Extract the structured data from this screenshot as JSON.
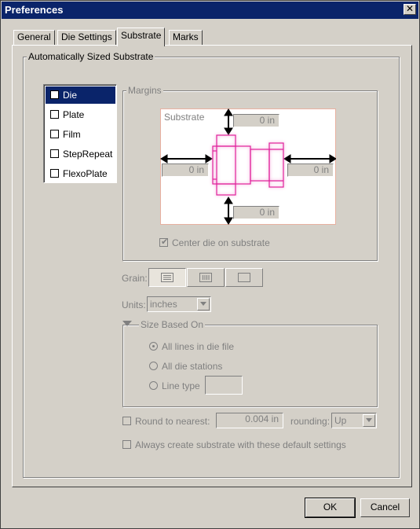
{
  "window": {
    "title": "Preferences",
    "close_label": "✕"
  },
  "tabs": [
    {
      "label": "General"
    },
    {
      "label": "Die Settings"
    },
    {
      "label": "Substrate"
    },
    {
      "label": "Marks"
    }
  ],
  "active_tab": "Substrate",
  "auto_group": {
    "label": "Automatically Sized Substrate"
  },
  "substrate_list": [
    {
      "label": "Die",
      "selected": true,
      "checked": false
    },
    {
      "label": "Plate",
      "selected": false,
      "checked": false
    },
    {
      "label": "Film",
      "selected": false,
      "checked": false
    },
    {
      "label": "StepRepeat",
      "selected": false,
      "checked": false
    },
    {
      "label": "FlexoPlate",
      "selected": false,
      "checked": false
    }
  ],
  "margins": {
    "label": "Margins",
    "preview_label": "Substrate",
    "top": "0 in",
    "left": "0 in",
    "right": "0 in",
    "bottom": "0 in",
    "center_label": "Center die on substrate",
    "center_checked": true
  },
  "grain": {
    "label": "Grain:",
    "icons": [
      "horizontal-grain-icon",
      "vertical-grain-icon",
      "no-grain-icon"
    ]
  },
  "units": {
    "label": "Units:",
    "value": "inches"
  },
  "size_based_on": {
    "label": "Size Based On",
    "options": [
      "All lines in die file",
      "All die stations",
      "Line type"
    ],
    "selected_index": 0,
    "line_type_value": ""
  },
  "round": {
    "label": "Round to nearest:",
    "value": "0.004 in",
    "rounding_label": "rounding:",
    "rounding_value": "Up",
    "checked": false
  },
  "always_create": {
    "label": "Always create substrate with these default settings",
    "checked": false
  },
  "buttons": {
    "ok": "OK",
    "cancel": "Cancel"
  },
  "colors": {
    "titlebar": "#0a246a",
    "die_outline": "#e0209a",
    "selection": "#0a246a"
  }
}
